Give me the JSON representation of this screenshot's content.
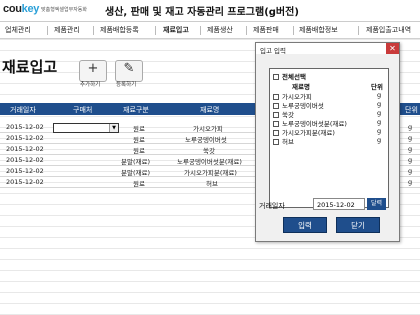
{
  "header": {
    "logo_prefix": "cou",
    "logo_suffix": "key",
    "tagline": "맞춤형엑셀업무자동화",
    "title": "생산, 판매 및 재고 자동관리 프로그램(g버전)"
  },
  "menu": [
    "업체관리",
    "제품관리",
    "제품배합등록",
    "재료입고",
    "제품생산",
    "제품판매",
    "제품배합정보",
    "제품입출고내역"
  ],
  "page_title": "재료입고",
  "toolbar": {
    "add_label": "추가하기",
    "register_label": "등록하기",
    "add_icon": "+",
    "register_icon": "✎"
  },
  "table": {
    "headers": [
      "거래일자",
      "구매처",
      "재료구분",
      "재료명",
      "입고수량",
      "단위"
    ],
    "rows": [
      {
        "date": "2015-12-02",
        "vendor": "",
        "category": "원료",
        "name": "가시오가피",
        "unit": "g"
      },
      {
        "date": "2015-12-02",
        "vendor": "",
        "category": "원료",
        "name": "노루궁뎅이버섯",
        "unit": "g"
      },
      {
        "date": "2015-12-02",
        "vendor": "",
        "category": "원료",
        "name": "쑥갓",
        "unit": "g"
      },
      {
        "date": "2015-12-02",
        "vendor": "",
        "category": "분말(재료)",
        "name": "노루궁뎅이버섯분(재료)",
        "unit": "g"
      },
      {
        "date": "2015-12-02",
        "vendor": "",
        "category": "분말(재료)",
        "name": "가시오가피분(재료)",
        "unit": "g"
      },
      {
        "date": "2015-12-02",
        "vendor": "",
        "category": "원료",
        "name": "허브",
        "unit": "g"
      }
    ]
  },
  "dialog": {
    "title": "입고 입력",
    "close_icon": "✕",
    "select_all": "전체선택",
    "col_name": "재료명",
    "col_unit": "단위",
    "items": [
      {
        "name": "가시오가피",
        "unit": "g"
      },
      {
        "name": "노루궁뎅이버섯",
        "unit": "g"
      },
      {
        "name": "쑥갓",
        "unit": "g"
      },
      {
        "name": "노루궁뎅이버섯분(재료)",
        "unit": "g"
      },
      {
        "name": "가시오가피분(재료)",
        "unit": "g"
      },
      {
        "name": "허브",
        "unit": "g"
      }
    ],
    "date_label": "거래일자",
    "date_value": "2015-12-02",
    "calendar_label": "달력",
    "input_button": "입력",
    "close_button": "닫기"
  },
  "colors": {
    "header_blue": "#1f4e8c",
    "logo_accent": "#2aa0d8"
  }
}
